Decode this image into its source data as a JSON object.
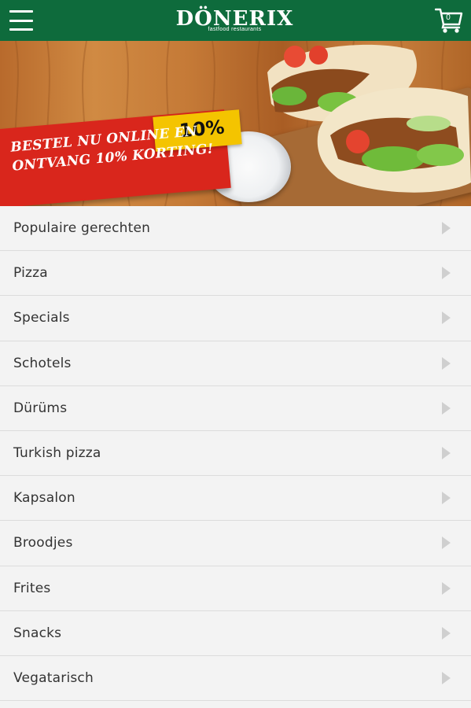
{
  "header": {
    "brand": "DÖNERIX",
    "brand_sub": "fastfood restaurants",
    "cart_count": "0",
    "icons": {
      "menu": "hamburger-menu-icon",
      "cart": "shopping-cart-icon"
    },
    "color": "#0e6b3c"
  },
  "banner": {
    "promo_badge": "10%",
    "promo_line1": "BESTEL NU ONLINE EN",
    "promo_line2": "ONTVANG 10% KORTING!",
    "ribbon_color": "#d9261c",
    "badge_color": "#f4c400"
  },
  "menu": {
    "items": [
      {
        "label": "Populaire gerechten"
      },
      {
        "label": "Pizza"
      },
      {
        "label": "Specials"
      },
      {
        "label": "Schotels"
      },
      {
        "label": "Dürüms"
      },
      {
        "label": "Turkish pizza"
      },
      {
        "label": "Kapsalon"
      },
      {
        "label": "Broodjes"
      },
      {
        "label": "Frites"
      },
      {
        "label": "Snacks"
      },
      {
        "label": "Vegatarisch"
      }
    ]
  }
}
